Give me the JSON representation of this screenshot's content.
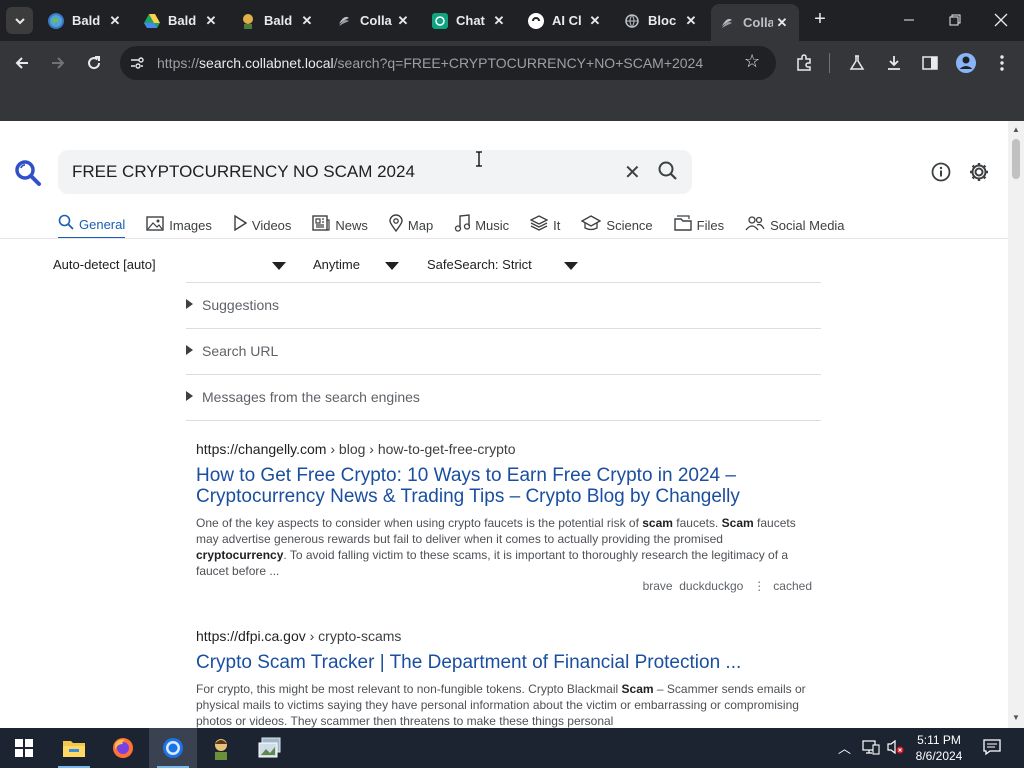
{
  "browser": {
    "tabs": [
      {
        "label": "Bald",
        "icon": "globe-icon",
        "fav_color": "#4a90d9"
      },
      {
        "label": "Bald",
        "icon": "drive-icon",
        "fav_color": "#f4b400"
      },
      {
        "label": "Bald",
        "icon": "avatar-icon",
        "fav_color": "#c9a227"
      },
      {
        "label": "Colla",
        "icon": "collabnet-icon",
        "fav_color": "#9aa0a6"
      },
      {
        "label": "Chat",
        "icon": "chatgpt-icon",
        "fav_color": "#10a37f"
      },
      {
        "label": "AI Cl",
        "icon": "ai-icon",
        "fav_color": "#ffffff"
      },
      {
        "label": "Bloc",
        "icon": "globe-icon",
        "fav_color": "#9aa0a6"
      },
      {
        "label": "Colla",
        "icon": "collabnet-icon",
        "fav_color": "#9aa0a6",
        "active": true
      }
    ],
    "url": {
      "scheme": "https://",
      "host": "search.collabnet.local",
      "path": "/search?q=FREE+CRYPTOCURRENCY+NO+SCAM+2024"
    }
  },
  "search": {
    "query": "FREE CRYPTOCURRENCY NO SCAM 2024"
  },
  "categories": [
    {
      "label": "General",
      "icon": "search-icon",
      "active": true
    },
    {
      "label": "Images",
      "icon": "image-icon"
    },
    {
      "label": "Videos",
      "icon": "play-icon"
    },
    {
      "label": "News",
      "icon": "news-icon"
    },
    {
      "label": "Map",
      "icon": "map-pin-icon"
    },
    {
      "label": "Music",
      "icon": "music-icon"
    },
    {
      "label": "It",
      "icon": "layers-icon"
    },
    {
      "label": "Science",
      "icon": "science-icon"
    },
    {
      "label": "Files",
      "icon": "files-icon"
    },
    {
      "label": "Social Media",
      "icon": "people-icon"
    }
  ],
  "filters": {
    "language": "Auto-detect [auto]",
    "time": "Anytime",
    "safesearch": "SafeSearch: Strict"
  },
  "expanders": [
    {
      "label": "Suggestions"
    },
    {
      "label": "Search URL"
    },
    {
      "label": "Messages from the search engines"
    }
  ],
  "results": [
    {
      "url_host": "https://changelly.com",
      "url_path": "› blog › how-to-get-free-crypto",
      "title": "How to Get Free Crypto: 10 Ways to Earn Free Crypto in 2024 – Cryptocurrency News & Trading Tips – Crypto Blog by Changelly",
      "snippet_parts": [
        {
          "t": "One of the key aspects to consider when using crypto faucets is the potential risk of "
        },
        {
          "t": "scam",
          "b": true
        },
        {
          "t": " faucets. "
        },
        {
          "t": "Scam",
          "b": true
        },
        {
          "t": " faucets may advertise generous rewards but fail to deliver when it comes to actually providing the promised "
        },
        {
          "t": "cryptocurrency",
          "b": true
        },
        {
          "t": ". To avoid falling victim to these scams, it is important to thoroughly research the legitimacy of a faucet before ..."
        }
      ],
      "engines": "brave  duckduckgo",
      "cached": "cached"
    },
    {
      "url_host": "https://dfpi.ca.gov",
      "url_path": "› crypto-scams",
      "title": "Crypto Scam Tracker | The Department of Financial Protection ...",
      "snippet_parts": [
        {
          "t": "For crypto, this might be most relevant to non-fungible tokens. Crypto Blackmail "
        },
        {
          "t": "Scam",
          "b": true
        },
        {
          "t": " – Scammer sends emails or physical mails to victims saying they have personal information about the victim or embarrassing or compromising photos or videos. They scammer then threatens to make these things personal"
        }
      ]
    }
  ],
  "taskbar": {
    "time": "5:11 PM",
    "date": "8/6/2024"
  }
}
